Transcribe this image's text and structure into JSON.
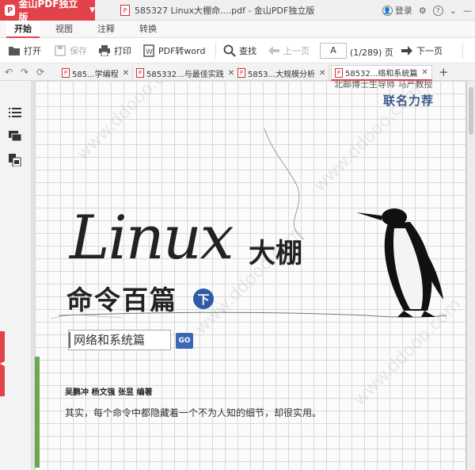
{
  "titlebar": {
    "brand": "金山PDF独立版",
    "document_title": "585327 Linux大棚命....pdf - 金山PDF独立版",
    "login": "登录"
  },
  "menu": [
    "开始",
    "视图",
    "注释",
    "转换"
  ],
  "toolbar": {
    "open": "打开",
    "save": "保存",
    "print": "打印",
    "pdf_to_word": "PDF转word",
    "find": "查找",
    "prev_page": "上一页",
    "page_value": "A",
    "page_count": "(1/289) 页",
    "next_page": "下一页"
  },
  "doc_tabs": [
    {
      "label": "585...学编程",
      "active": false
    },
    {
      "label": "585332...与最佳实践",
      "active": false
    },
    {
      "label": "5853...大规模分析",
      "active": false
    },
    {
      "label": "58532...络和系统篇",
      "active": true
    }
  ],
  "cover": {
    "top_note": "北邮博士生导师 马严教授",
    "recommend": "联名力荐",
    "title_latin": "Linux",
    "title_cn": "大棚",
    "subtitle": "命令百篇",
    "volume": "下",
    "series": "网络和系统篇",
    "go": "GO",
    "authors": "吴鹏冲  杨文强  张昱  编著",
    "tagline": "其实，每个命令中都隐藏着一个不为人知的细节，却很实用。",
    "watermark": "www.ddooo.com"
  }
}
